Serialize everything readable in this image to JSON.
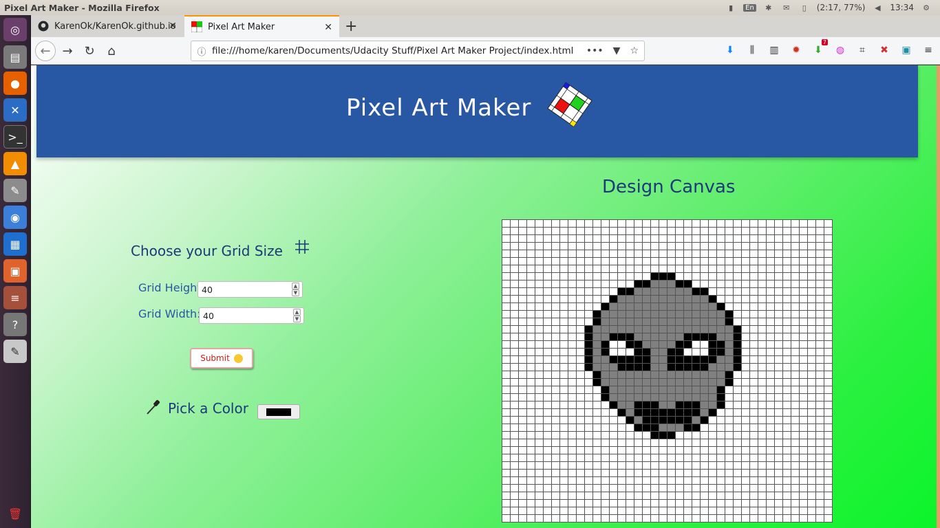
{
  "os": {
    "window_title": "Pixel Art Maker - Mozilla Firefox",
    "keyboard_layout": "En",
    "battery": "(2:17, 77%)",
    "clock": "13:34"
  },
  "browser": {
    "tabs": [
      {
        "label": "KarenOk/KarenOk.github.io",
        "icon": "github-icon",
        "active": false
      },
      {
        "label": "Pixel Art Maker",
        "icon": "pixel-art-favicon",
        "active": true
      }
    ],
    "url": "file:///home/karen/Documents/Udacity Stuff/Pixel Art Maker Project/index.html",
    "addon_badge": "7"
  },
  "page": {
    "header_title": "Pixel Art Maker",
    "grid_size_title": "Choose your Grid Size",
    "height_label": "Grid Height:",
    "width_label": "Grid Width:",
    "height_value": "40",
    "width_value": "40",
    "submit_label": "Submit",
    "pick_color_label": "Pick a Color",
    "selected_color": "#000000",
    "canvas_title": "Design Canvas",
    "header_color": "#2857a4"
  },
  "canvas": {
    "rows": 40,
    "cols": 40,
    "colors": {
      "k": "#000000",
      "g": "#808080",
      ".": "#ffffff"
    },
    "art": [
      "........................................",
      "........................................",
      "........................................",
      "........................................",
      "........................................",
      "........................................",
      "........................................",
      "..................kkk...................",
      "................kkgggkk.................",
      "..............kkgggggggkk...............",
      ".............kgggggggggggk..............",
      "............kgggggggggggggk.............",
      "...........kgggggggggggggggk............",
      "...........kgggggggggggggggk............",
      "..........kgggggggggggggggggk...........",
      "..........kggkkkggggggkkkkggk...........",
      "..........kgk..kkggggkk..kkgk...........",
      "..........kgk...kkggkk...kkgk...........",
      "..........kggkkkkkggkkkkkkggk...........",
      "..........kgggkkkkggkkkkkgggk...........",
      "...........kgggggggggggggggk............",
      "...........kgggggggggggggggk............",
      "............kgggggggggggggk.............",
      "............kgggggggggggggk.............",
      ".............kggkkkggkkkggk.............",
      "..............kgkkkkkkkkgk..............",
      "...............kgkkkkkkgk...............",
      "................kkkgggkk................",
      "..................kkk...................",
      "........................................",
      "........................................",
      "........................................",
      "........................................",
      "........................................",
      "........................................",
      "........................................",
      "........................................",
      "........................................",
      "........................................",
      "........................................"
    ]
  }
}
